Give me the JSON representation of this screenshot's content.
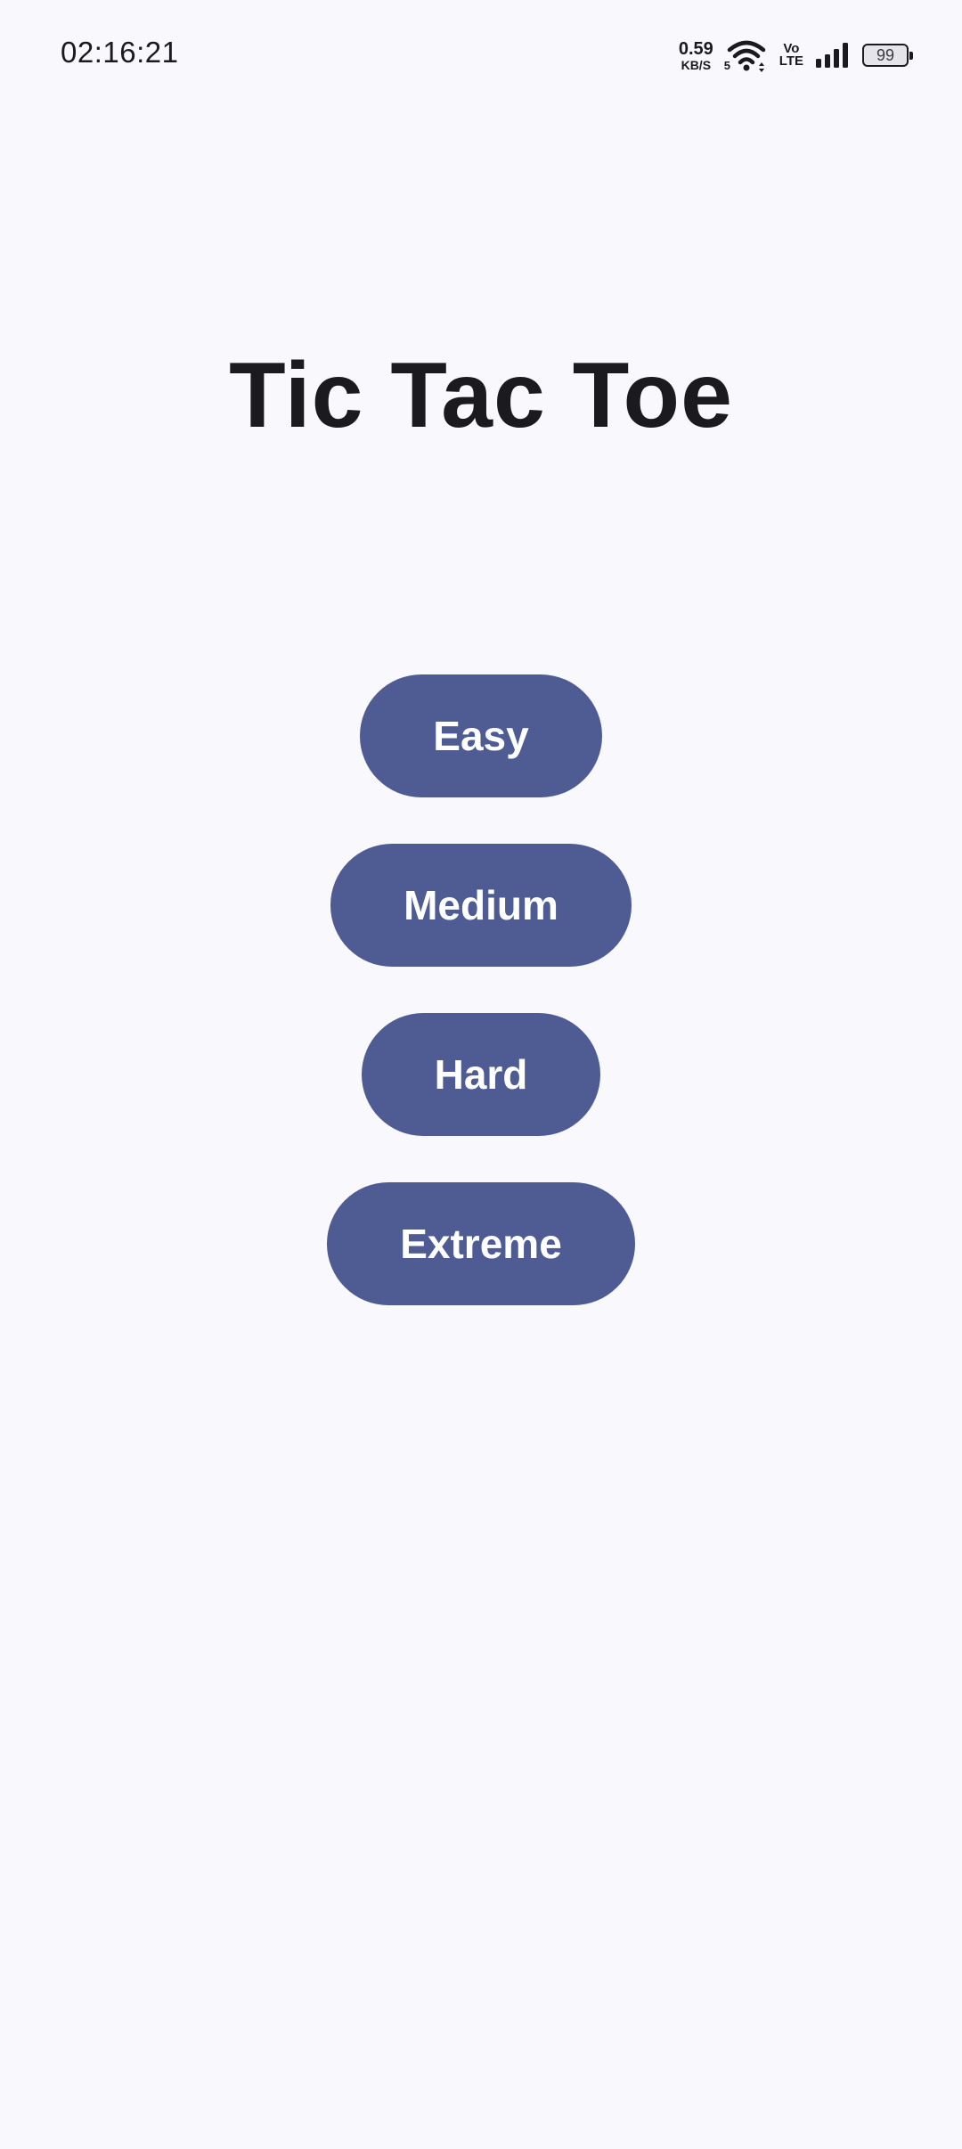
{
  "status_bar": {
    "time": "02:16:21",
    "net_speed_value": "0.59",
    "net_speed_unit": "KB/S",
    "wifi_generation": "5",
    "volte_top": "Vo",
    "volte_bottom": "LTE",
    "battery_level": "99",
    "icons": [
      "wifi-icon",
      "signal-icon",
      "battery-icon"
    ]
  },
  "app": {
    "title": "Tic Tac Toe"
  },
  "difficulty_menu": {
    "buttons": [
      {
        "label": "Easy"
      },
      {
        "label": "Medium"
      },
      {
        "label": "Hard"
      },
      {
        "label": "Extreme"
      }
    ]
  },
  "colors": {
    "background": "#f8f8fd",
    "button": "#4e5c93",
    "button_text": "#ffffff",
    "title": "#1b1b1f"
  }
}
